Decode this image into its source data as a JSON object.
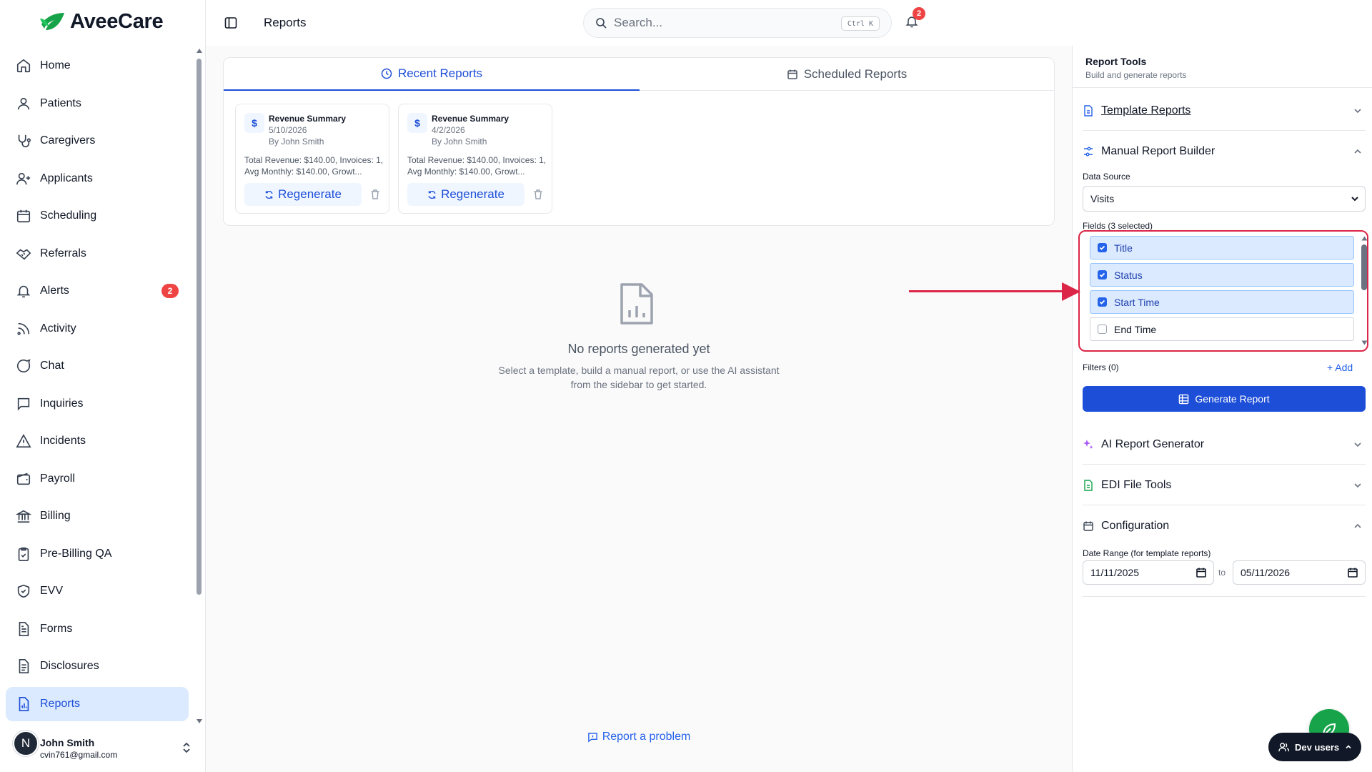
{
  "app": {
    "brand": "AveeCare",
    "page_title": "Reports"
  },
  "search": {
    "placeholder": "Search...",
    "shortcut": "Ctrl K"
  },
  "notifications": {
    "count": "2"
  },
  "sidebar": {
    "items": [
      {
        "label": "Home",
        "icon": "home-icon"
      },
      {
        "label": "Patients",
        "icon": "user-icon"
      },
      {
        "label": "Caregivers",
        "icon": "stethoscope-icon"
      },
      {
        "label": "Applicants",
        "icon": "user-plus-icon"
      },
      {
        "label": "Scheduling",
        "icon": "calendar-icon"
      },
      {
        "label": "Referrals",
        "icon": "handshake-icon"
      },
      {
        "label": "Alerts",
        "icon": "bell-icon",
        "badge": "2"
      },
      {
        "label": "Activity",
        "icon": "rss-icon"
      },
      {
        "label": "Chat",
        "icon": "chat-icon"
      },
      {
        "label": "Inquiries",
        "icon": "message-square-icon"
      },
      {
        "label": "Incidents",
        "icon": "alert-triangle-icon"
      },
      {
        "label": "Payroll",
        "icon": "wallet-icon"
      },
      {
        "label": "Billing",
        "icon": "bank-icon"
      },
      {
        "label": "Pre-Billing QA",
        "icon": "clipboard-check-icon"
      },
      {
        "label": "EVV",
        "icon": "shield-check-icon"
      },
      {
        "label": "Forms",
        "icon": "file-text-icon"
      },
      {
        "label": "Disclosures",
        "icon": "file-list-icon"
      },
      {
        "label": "Reports",
        "icon": "file-chart-icon",
        "active": true
      }
    ],
    "user": {
      "initial": "N",
      "name": "John Smith",
      "email": "cvin761@gmail.com"
    }
  },
  "tabs": [
    {
      "label": "Recent Reports",
      "active": true
    },
    {
      "label": "Scheduled Reports",
      "active": false
    }
  ],
  "recent_reports": [
    {
      "title": "Revenue Summary",
      "date": "5/10/2026",
      "author": "By John Smith",
      "summary": "Total Revenue: $140.00, Invoices: 1, Avg Monthly: $140.00, Growt...",
      "action": "Regenerate",
      "icon": "$"
    },
    {
      "title": "Revenue Summary",
      "date": "4/2/2026",
      "author": "By John Smith",
      "summary": "Total Revenue: $140.00, Invoices: 1, Avg Monthly: $140.00, Growt...",
      "action": "Regenerate",
      "icon": "$"
    }
  ],
  "empty_state": {
    "title": "No reports generated yet",
    "line1": "Select a template, build a manual report, or use the AI assistant",
    "line2": "from the sidebar to get started."
  },
  "footer": {
    "report_problem": "Report a problem"
  },
  "report_tools": {
    "title": "Report Tools",
    "subtitle": "Build and generate reports",
    "sections": {
      "template": "Template Reports",
      "manual": "Manual Report Builder",
      "ai": "AI Report Generator",
      "edi": "EDI File Tools",
      "config": "Configuration"
    },
    "manual_builder": {
      "data_source_label": "Data Source",
      "data_source_value": "Visits",
      "fields_label": "Fields (3 selected)",
      "fields": [
        {
          "label": "Title",
          "checked": true
        },
        {
          "label": "Status",
          "checked": true
        },
        {
          "label": "Start Time",
          "checked": true
        },
        {
          "label": "End Time",
          "checked": false
        }
      ],
      "filters_label": "Filters (0)",
      "add_label": "+ Add",
      "generate_label": "Generate Report"
    },
    "configuration": {
      "date_range_label": "Date Range (for template reports)",
      "start_date": "11/11/2025",
      "to_label": "to",
      "end_date": "05/11/2026"
    }
  },
  "dev_users": {
    "label": "Dev users"
  },
  "colors": {
    "accent": "#1d4ed8",
    "highlight": "#dc2647",
    "badge": "#ef4444",
    "brand_green": "#16a34a"
  }
}
